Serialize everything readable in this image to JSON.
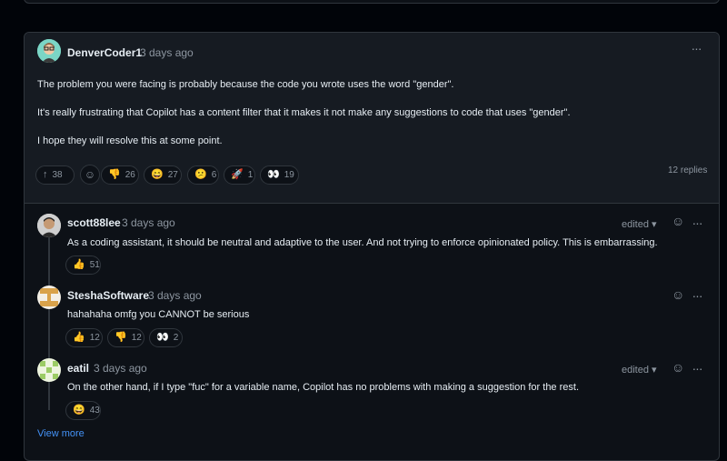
{
  "main_comment": {
    "author": "DenverCoder1",
    "time": "3 days ago",
    "paragraphs": [
      "The problem you were facing is probably because the code you wrote uses the word \"gender\".",
      "It's really frustrating that Copilot has a content filter that it makes it not make any suggestions to code that uses \"gender\".",
      "I hope they will resolve this at some point."
    ],
    "upvote": {
      "icon": "arrow-up-icon",
      "count": "38"
    },
    "reactions": [
      {
        "icon": "thumbs-down-icon",
        "glyph": "👎",
        "count": "26"
      },
      {
        "icon": "laugh-icon",
        "glyph": "😄",
        "count": "27"
      },
      {
        "icon": "confused-icon",
        "glyph": "😕",
        "count": "6"
      },
      {
        "icon": "rocket-icon",
        "glyph": "🚀",
        "count": "1"
      },
      {
        "icon": "eyes-icon",
        "glyph": "👀",
        "count": "19"
      }
    ],
    "replies_label": "12 replies"
  },
  "replies": [
    {
      "author": "scott88lee",
      "time": "3 days ago",
      "edited": "edited",
      "text": "As a coding assistant, it should be neutral and adaptive to the user. And not trying to enforce opinionated policy. This is embarrassing.",
      "reactions": [
        {
          "icon": "thumbs-up-icon",
          "glyph": "👍",
          "count": "51"
        }
      ]
    },
    {
      "author": "SteshaSoftware",
      "time": "3 days ago",
      "edited": "",
      "text": "hahahaha omfg you CANNOT be serious",
      "reactions": [
        {
          "icon": "thumbs-up-icon",
          "glyph": "👍",
          "count": "12"
        },
        {
          "icon": "thumbs-down-icon",
          "glyph": "👎",
          "count": "12"
        },
        {
          "icon": "eyes-icon",
          "glyph": "👀",
          "count": "2"
        }
      ]
    },
    {
      "author": "eatil",
      "time": "3 days ago",
      "edited": "edited",
      "text": "On the other hand, if I type \"fuc\" for a variable name, Copilot has no problems with making a suggestion for the rest.",
      "reactions": [
        {
          "icon": "laugh-icon",
          "glyph": "😄",
          "count": "43"
        }
      ]
    }
  ],
  "view_more": "View more",
  "glyphs": {
    "more": "···",
    "smile": "☺",
    "edited_caret": "▾",
    "upvote": "↑",
    "add_reaction": "☺"
  },
  "colors": {
    "background": "#010409",
    "card": "#0d1117",
    "header": "#161b22",
    "border": "#30363d",
    "link": "#4493f8",
    "muted": "#8d96a0"
  }
}
